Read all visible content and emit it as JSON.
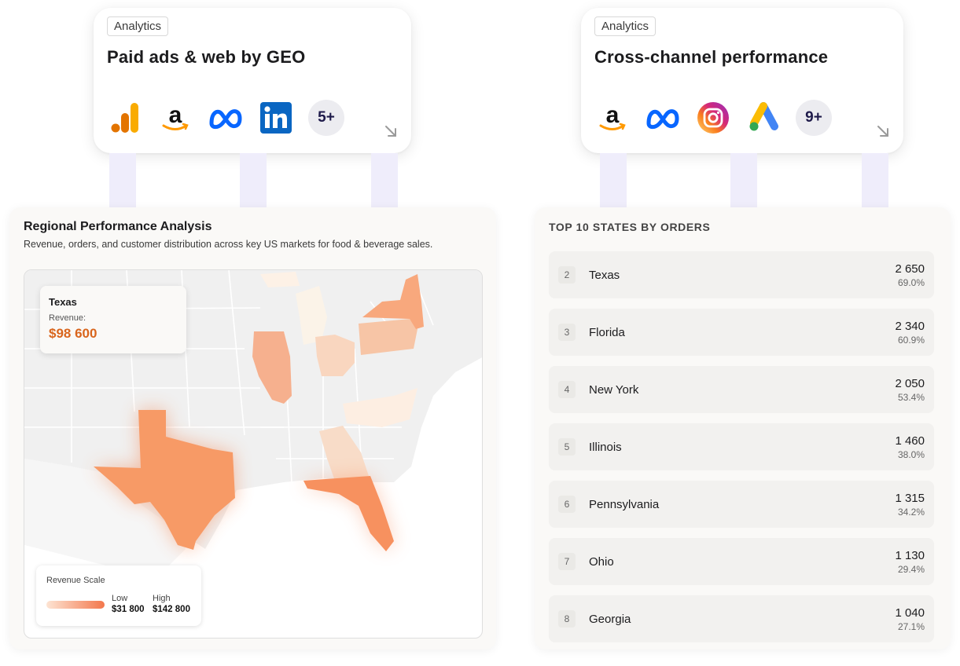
{
  "cards": {
    "left": {
      "tag": "Analytics",
      "title": "Paid ads & web by GEO",
      "more": "5+",
      "icons": [
        "google-analytics-icon",
        "amazon-icon",
        "meta-icon",
        "linkedin-icon"
      ]
    },
    "right": {
      "tag": "Analytics",
      "title": "Cross-channel performance",
      "more": "9+",
      "icons": [
        "amazon-icon",
        "meta-icon",
        "instagram-icon",
        "google-ads-icon"
      ]
    }
  },
  "map_panel": {
    "title": "Regional Performance Analysis",
    "subtitle": "Revenue, orders, and customer distribution across key US markets for food & beverage sales.",
    "tooltip": {
      "state": "Texas",
      "label": "Revenue:",
      "value": "$98 600"
    },
    "legend": {
      "title": "Revenue Scale",
      "low_label": "Low",
      "high_label": "High",
      "low_value": "$31 800",
      "high_value": "$142 800",
      "colors": {
        "low": "#fde4d3",
        "high": "#f3774c"
      }
    }
  },
  "states_panel": {
    "title": "TOP 10 STATES BY ORDERS",
    "rows": [
      {
        "rank": "2",
        "name": "Texas",
        "orders": "2 650",
        "pct": "69.0%"
      },
      {
        "rank": "3",
        "name": "Florida",
        "orders": "2 340",
        "pct": "60.9%"
      },
      {
        "rank": "4",
        "name": "New York",
        "orders": "2 050",
        "pct": "53.4%"
      },
      {
        "rank": "5",
        "name": "Illinois",
        "orders": "1 460",
        "pct": "38.0%"
      },
      {
        "rank": "6",
        "name": "Pennsylvania",
        "orders": "1 315",
        "pct": "34.2%"
      },
      {
        "rank": "7",
        "name": "Ohio",
        "orders": "1 130",
        "pct": "29.4%"
      },
      {
        "rank": "8",
        "name": "Georgia",
        "orders": "1 040",
        "pct": "27.1%"
      }
    ]
  },
  "colors": {
    "accent": "#d9651c",
    "pillar": "#efedfb"
  }
}
